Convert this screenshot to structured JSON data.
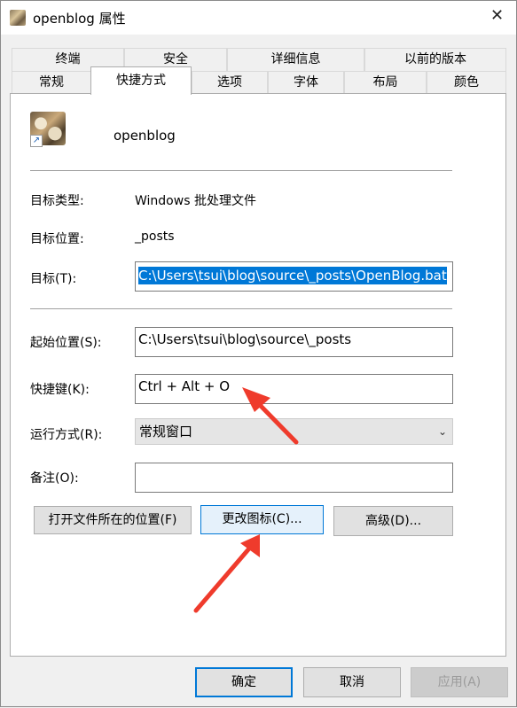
{
  "window": {
    "title": "openblog 属性",
    "close_glyph": "✕"
  },
  "tabs_back": [
    "终端",
    "安全",
    "详细信息",
    "以前的版本"
  ],
  "tabs_front": [
    "常规",
    "快捷方式",
    "选项",
    "字体",
    "布局",
    "颜色"
  ],
  "active_tab": "快捷方式",
  "shortcut": {
    "name": "openblog",
    "target_type_label": "目标类型:",
    "target_type_value": "Windows 批处理文件",
    "target_location_label": "目标位置:",
    "target_location_value": "_posts",
    "target_label": "目标(T):",
    "target_value": "C:\\Users\\tsui\\blog\\source\\_posts\\OpenBlog.bat",
    "start_in_label": "起始位置(S):",
    "start_in_value": "C:\\Users\\tsui\\blog\\source\\_posts",
    "hotkey_label": "快捷键(K):",
    "hotkey_value": "Ctrl + Alt + O",
    "run_label": "运行方式(R):",
    "run_value": "常规窗口",
    "comment_label": "备注(O):",
    "comment_value": ""
  },
  "buttons": {
    "open_location": "打开文件所在的位置(F)",
    "change_icon": "更改图标(C)...",
    "advanced": "高级(D)...",
    "ok": "确定",
    "cancel": "取消",
    "apply": "应用(A)"
  },
  "icons": {
    "app": "avatar-photo-icon",
    "shortcut_overlay": "shortcut-arrow-icon",
    "dropdown": "chevron-down-icon",
    "annotation": "red-arrow-icon"
  },
  "colors": {
    "accent": "#0078d7",
    "annotation": "#ef3b2c"
  }
}
